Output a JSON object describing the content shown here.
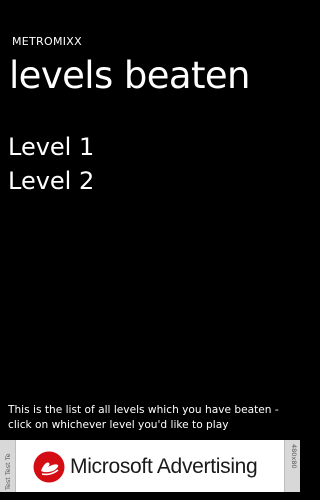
{
  "app": {
    "name": "METROMIXX"
  },
  "page": {
    "title": "levels beaten"
  },
  "levels": [
    {
      "label": "Level 1"
    },
    {
      "label": "Level 2"
    }
  ],
  "instructions": {
    "text": "This is the list of all levels which you have beaten - click on whichever level you'd like to play"
  },
  "ad": {
    "brand": "Microsoft Advertising",
    "test_strip": "Test Test Te",
    "size_label": "480x80",
    "logo_icon": "microsoft-advertising-logo-icon",
    "logo_color": "#d40c14"
  }
}
